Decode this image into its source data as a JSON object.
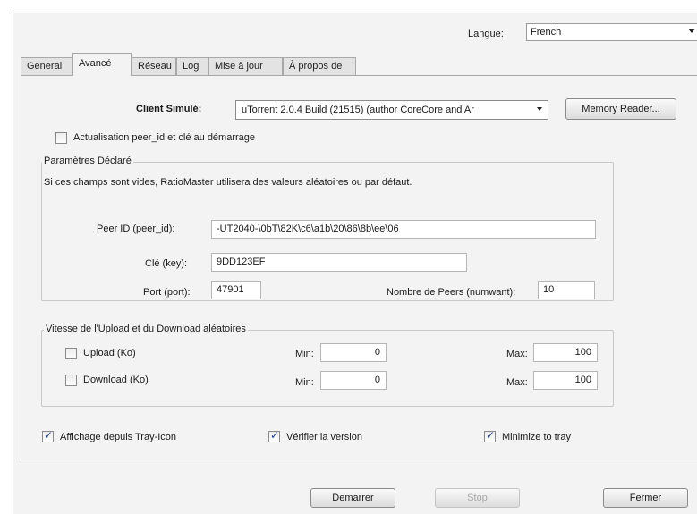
{
  "language": {
    "label": "Langue:",
    "value": "French"
  },
  "tabs": [
    {
      "label": "General"
    },
    {
      "label": "Avancé"
    },
    {
      "label": "Réseau"
    },
    {
      "label": "Log"
    },
    {
      "label": "Mise à jour"
    },
    {
      "label": "À propos de"
    }
  ],
  "client": {
    "label": "Client Simulé:",
    "value": "uTorrent 2.0.4 Build (21515) (author CoreCore and Ar",
    "memory_reader": "Memory Reader..."
  },
  "peer_refresh": {
    "label": "Actualisation peer_id et clé au démarrage",
    "checked": false
  },
  "declared": {
    "title": "Paramètres Déclaré",
    "note": "Si ces champs sont vides, RatioMaster utilisera des valeurs aléatoires ou par défaut.",
    "peer_id_label": "Peer ID (peer_id):",
    "peer_id_value": "-UT2040-\\0bT\\82K\\c6\\a1b\\20\\86\\8b\\ee\\06",
    "key_label": "Clé (key):",
    "key_value": "9DD123EF",
    "port_label": "Port (port):",
    "port_value": "47901",
    "peers_label": "Nombre de Peers (numwant):",
    "peers_value": "10"
  },
  "speed": {
    "title": "Vitesse de l'Upload et du Download aléatoires",
    "upload_label": "Upload (Ko)",
    "download_label": "Download (Ko)",
    "min_label": "Min:",
    "max_label": "Max:",
    "upload_min": "0",
    "upload_max": "100",
    "download_min": "0",
    "download_max": "100"
  },
  "options": {
    "tray_icon": "Affichage depuis Tray-Icon",
    "check_version": "Vérifier la version",
    "minimize": "Minimize to tray"
  },
  "buttons": {
    "start": "Demarrer",
    "stop": "Stop",
    "close": "Fermer"
  }
}
